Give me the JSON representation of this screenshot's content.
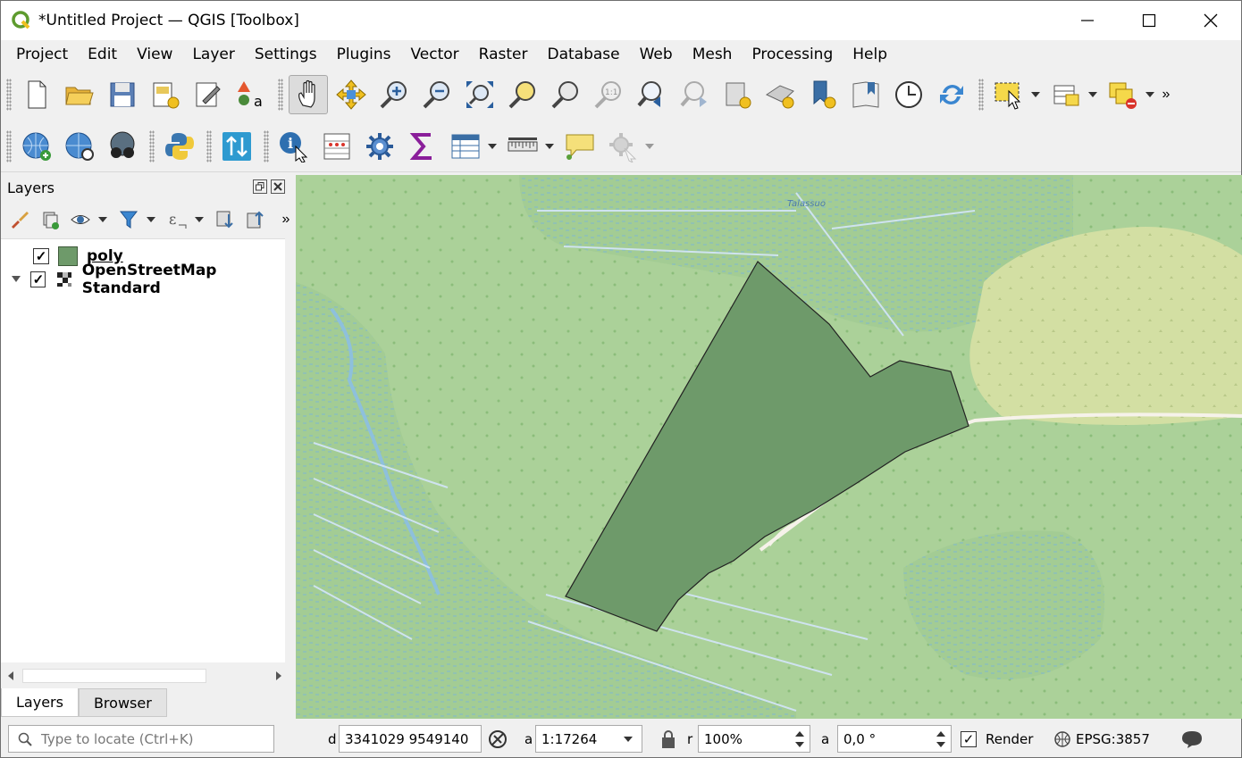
{
  "window": {
    "title": "*Untitled Project — QGIS [Toolbox]"
  },
  "menu": [
    "Project",
    "Edit",
    "View",
    "Layer",
    "Settings",
    "Plugins",
    "Vector",
    "Raster",
    "Database",
    "Web",
    "Mesh",
    "Processing",
    "Help"
  ],
  "toolbar1": {
    "icons": [
      "new-project-icon",
      "open-project-icon",
      "save-project-icon",
      "new-print-layout-icon",
      "layout-manager-icon",
      "style-manager-icon",
      "pan-icon",
      "pan-to-selection-icon",
      "zoom-in-icon",
      "zoom-out-icon",
      "zoom-full-icon",
      "zoom-to-selection-icon",
      "zoom-to-layer-icon",
      "zoom-native-icon",
      "zoom-last-icon",
      "zoom-next-icon",
      "new-map-view-icon",
      "new-3d-map-view-icon",
      "new-spatial-bookmark-icon",
      "show-bookmarks-icon",
      "temporal-controller-icon",
      "refresh-icon",
      "select-features-icon",
      "open-attribute-table-icon",
      "deselect-all-icon"
    ]
  },
  "toolbar2": {
    "icons": [
      "add-wms-layer-icon",
      "add-wfs-layer-icon",
      "metasearch-icon",
      "python-console-icon",
      "sort-icon",
      "identify-features-icon",
      "field-calculator-icon",
      "processing-toolbox-icon",
      "statistical-summary-icon",
      "attribute-table-icon",
      "measure-line-icon",
      "text-annotation-icon",
      "action-icon"
    ]
  },
  "layers_panel": {
    "title": "Layers",
    "layers": [
      {
        "name": "poly",
        "checked": true,
        "symbol_color": "#6e9a6a"
      },
      {
        "name": "OpenStreetMap Standard",
        "checked": true,
        "expanded": true
      }
    ],
    "tabs": [
      "Layers",
      "Browser"
    ]
  },
  "map": {
    "label_name": "Talassuo",
    "polygon_fill": "#6e9a6a",
    "background_color": "#a9d095"
  },
  "status": {
    "locator_placeholder": "Type to locate (Ctrl+K)",
    "coord_label": "d",
    "coordinate": "3341029  9549140",
    "scale_label": "a",
    "scale": "1:17264",
    "magnifier_label": "r",
    "magnifier": "100%",
    "rotation_label": "a",
    "rotation": "0,0 °",
    "render_label": "Render",
    "render_checked": true,
    "crs": "EPSG:3857"
  }
}
